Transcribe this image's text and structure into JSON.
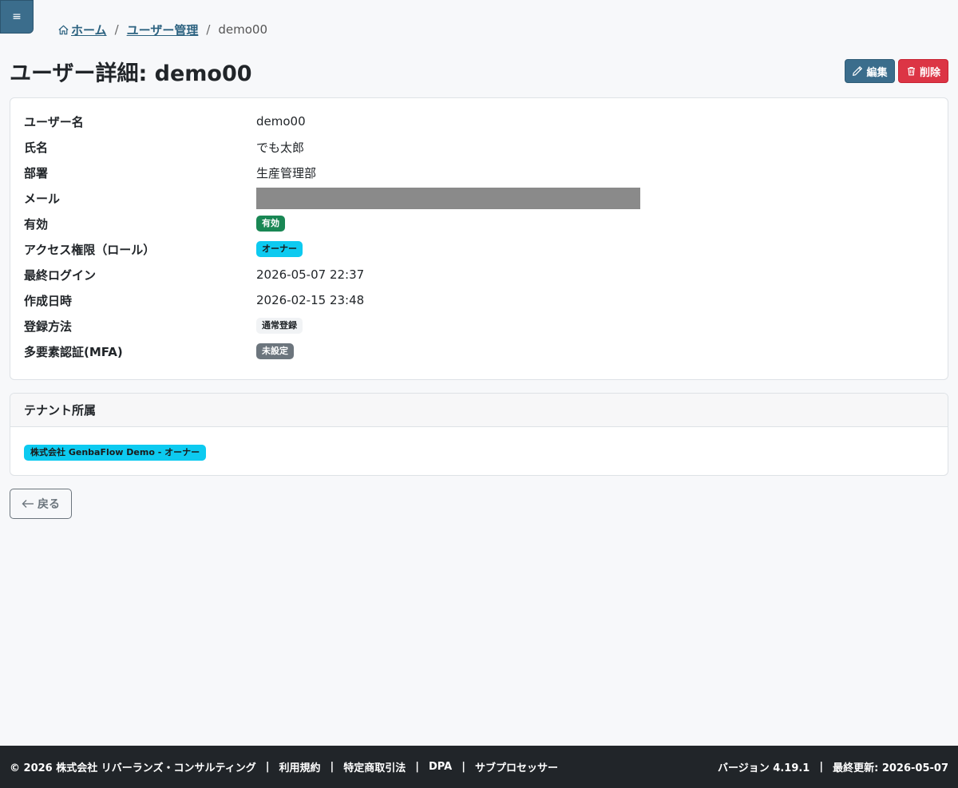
{
  "header": {
    "menu_icon": "≡",
    "breadcrumb": {
      "home": "ホーム",
      "users": "ユーザー管理",
      "current": "demo00",
      "separator": "/"
    },
    "title": "ユーザー詳細: demo00",
    "edit_label": "編集",
    "delete_label": "削除"
  },
  "details": {
    "rows": [
      {
        "label": "ユーザー名",
        "value": "demo00"
      },
      {
        "label": "氏名",
        "value": "でも太郎"
      },
      {
        "label": "部署",
        "value": "生産管理部"
      },
      {
        "label": "メール",
        "value": ""
      },
      {
        "label": "有効",
        "value": "有効"
      },
      {
        "label": "アクセス権限（ロール）",
        "value": "オーナー"
      },
      {
        "label": "最終ログイン",
        "value": "2026-05-07 22:37"
      },
      {
        "label": "作成日時",
        "value": "2026-02-15 23:48"
      },
      {
        "label": "登録方法",
        "value": "通常登録"
      },
      {
        "label": "多要素認証(MFA)",
        "value": "未設定"
      }
    ]
  },
  "tenant": {
    "header": "テナント所属",
    "badge": "株式会社 GenbaFlow Demo - オーナー"
  },
  "back_label": "戻る",
  "footer": {
    "copyright": "© 2026 株式会社 リバーランズ・コンサルティング",
    "links": [
      "利用規約",
      "特定商取引法",
      "DPA",
      "サブプロセッサー"
    ],
    "version": "バージョン 4.19.1",
    "updated": "最終更新: 2026-05-07",
    "separator": "|"
  },
  "colors": {
    "primary": "#3b6d8c",
    "danger": "#dc3545",
    "success": "#198754",
    "info": "#0dcaf0",
    "secondary": "#6c757d"
  }
}
